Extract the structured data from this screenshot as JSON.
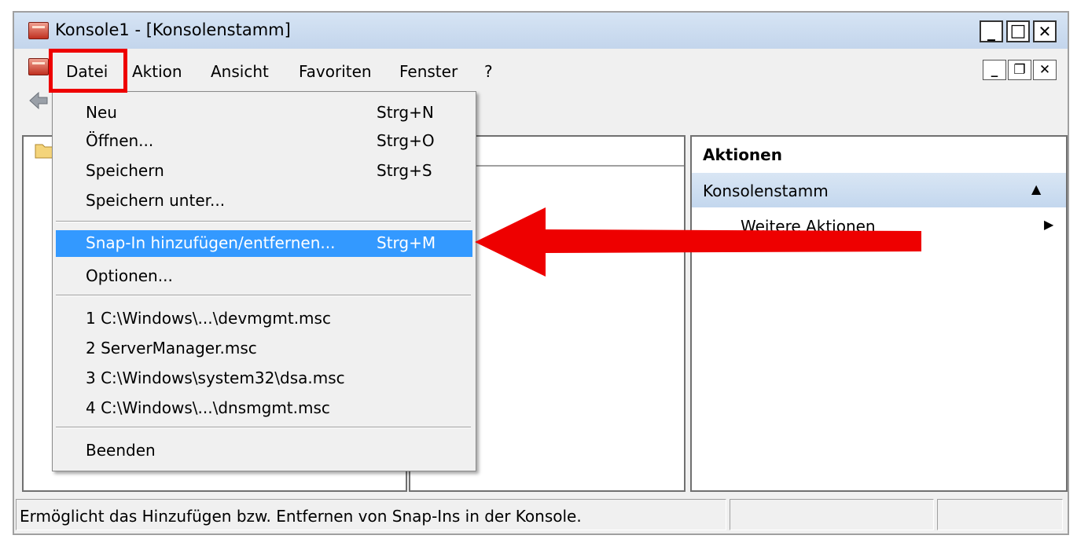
{
  "window": {
    "title": "Konsole1 - [Konsolenstamm]",
    "controls": {
      "minimize": "_",
      "maximize": "□",
      "close": "✕"
    }
  },
  "menubar": {
    "items": [
      "Datei",
      "Aktion",
      "Ansicht",
      "Favoriten",
      "Fenster",
      "?"
    ],
    "mdi_controls": {
      "minimize": "_",
      "restore": "❐",
      "close": "✕"
    }
  },
  "file_menu": {
    "items": [
      {
        "label": "Neu",
        "shortcut": "Strg+N"
      },
      {
        "label": "Öffnen...",
        "shortcut": "Strg+O"
      },
      {
        "label": "Speichern",
        "shortcut": "Strg+S"
      },
      {
        "label": "Speichern unter...",
        "shortcut": ""
      },
      {
        "label": "Snap-In hinzufügen/entfernen...",
        "shortcut": "Strg+M"
      },
      {
        "label": "Optionen...",
        "shortcut": ""
      },
      {
        "label": "1 C:\\Windows\\...\\devmgmt.msc",
        "shortcut": ""
      },
      {
        "label": "2 ServerManager.msc",
        "shortcut": ""
      },
      {
        "label": "3 C:\\Windows\\system32\\dsa.msc",
        "shortcut": ""
      },
      {
        "label": "4 C:\\Windows\\...\\dnsmgmt.msc",
        "shortcut": ""
      },
      {
        "label": "Beenden",
        "shortcut": ""
      }
    ]
  },
  "actions_pane": {
    "header": "Aktionen",
    "section": "Konsolenstamm",
    "section_arrow": "▲",
    "item": "Weitere Aktionen",
    "item_arrow": "▶"
  },
  "statusbar": {
    "text": "Ermöglicht das Hinzufügen bzw. Entfernen von Snap-Ins in der Konsole."
  },
  "colors": {
    "highlight": "#3399ff",
    "annotation_red": "#ee0000",
    "actions_section_bg": "#c9dcf0"
  },
  "icons": [
    "app-icon",
    "back-arrow-icon",
    "folder-icon",
    "annotation-arrow"
  ]
}
